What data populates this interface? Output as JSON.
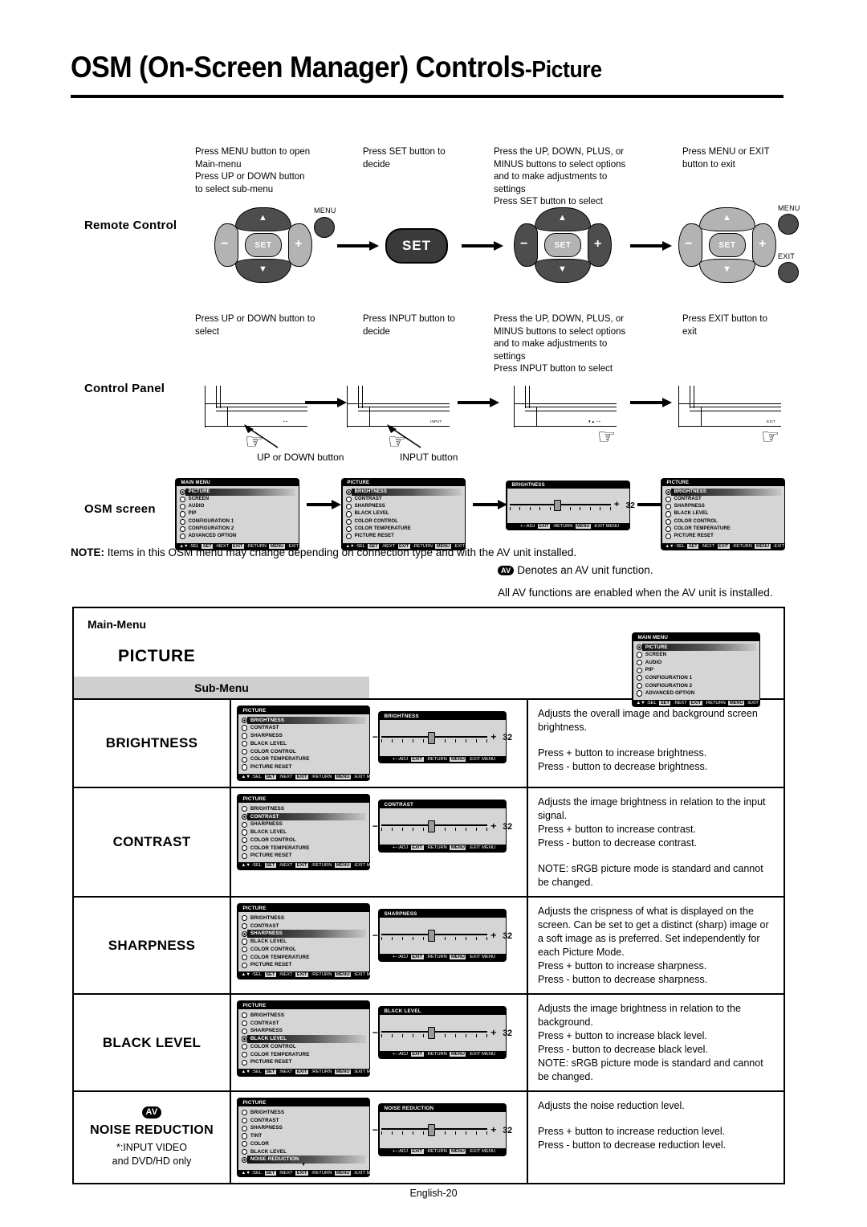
{
  "page": {
    "title_main": "OSM (On-Screen Manager) Controls",
    "title_sub": "-Picture",
    "footer": "English-20"
  },
  "rows": {
    "remote_label": "Remote Control",
    "control_label": "Control Panel",
    "osm_label": "OSM screen"
  },
  "remote_captions": [
    "Press MENU button to open\nMain-menu\nPress UP or DOWN button\nto select sub-menu",
    "Press SET button to\ndecide",
    "Press the UP, DOWN, PLUS, or\nMINUS buttons to select options\nand to make adjustments to\nsettings\nPress SET button to select",
    "Press MENU or EXIT\nbutton to exit"
  ],
  "panel_captions": [
    "Press UP or DOWN button to\nselect",
    "Press INPUT button to\ndecide",
    "Press the UP, DOWN, PLUS, or\nMINUS buttons to select options\nand to make adjustments to\nsettings\nPress INPUT button to select",
    "Press EXIT button to\nexit"
  ],
  "remote_buttons": {
    "set": "SET",
    "menu": "MENU",
    "exit": "EXIT",
    "plus": "+",
    "minus": "−",
    "up": "▲",
    "down": "▼"
  },
  "panel_hints": {
    "up_down": "UP or DOWN button",
    "input": "INPUT button",
    "panel_marks_1": "• •",
    "panel_marks_2": "INPUT",
    "panel_marks_3": "▼▲ −+",
    "panel_marks_4": "EXIT"
  },
  "note": {
    "label": "NOTE:",
    "line1": "Items in this OSM menu may change depending on connection type and with the AV unit installed.",
    "av_chip": "AV",
    "line2": "Denotes an AV unit function.",
    "line3": "All AV functions are enabled when the AV unit is installed."
  },
  "table_header": {
    "main_menu": "Main-Menu",
    "picture": "PICTURE",
    "sub_menu": "Sub-Menu"
  },
  "osm": {
    "footer_nav": [
      {
        "text": "▲▼ :SEL ",
        "key": false
      },
      {
        "text": "SET",
        "key": true
      },
      {
        "text": " :NEXT ",
        "key": false
      },
      {
        "text": "EXIT",
        "key": true
      },
      {
        "text": " :RETURN ",
        "key": false
      },
      {
        "text": "MENU",
        "key": true
      },
      {
        "text": " :EXIT MENU",
        "key": false
      }
    ],
    "footer_adj": [
      {
        "text": "+−:ADJ ",
        "key": false
      },
      {
        "text": "EXIT",
        "key": true
      },
      {
        "text": " :RETURN ",
        "key": false
      },
      {
        "text": "MENU",
        "key": true
      },
      {
        "text": " :EXIT MENU",
        "key": false
      }
    ],
    "main_menu": {
      "title": "MAIN MENU",
      "items": [
        "PICTURE",
        "SCREEN",
        "AUDIO",
        "PIP",
        "CONFIGURATION 1",
        "CONFIGURATION 2",
        "ADVANCED OPTION"
      ],
      "selected": 0
    },
    "picture_menu": {
      "title": "PICTURE",
      "items": [
        "BRIGHTNESS",
        "CONTRAST",
        "SHARPNESS",
        "BLACK LEVEL",
        "COLOR CONTROL",
        "COLOR TEMPERATURE",
        "PICTURE RESET"
      ]
    },
    "picture_menu_av": {
      "title": "PICTURE",
      "items": [
        "BRIGHTNESS",
        "CONTRAST",
        "SHARPNESS",
        "TINT",
        "COLOR",
        "BLACK LEVEL",
        "NOISE REDUCTION"
      ],
      "more": "▼"
    },
    "slider": {
      "value": "32",
      "minus": "−",
      "plus": "+"
    }
  },
  "table_rows": [
    {
      "name": "BRIGHTNESS",
      "menu_title": "PICTURE",
      "selected": 0,
      "slider_title": "BRIGHTNESS",
      "desc": [
        "Adjusts the overall image and background screen brightness.",
        "",
        "Press + button to increase brightness.",
        "Press - button to decrease brightness."
      ]
    },
    {
      "name": "CONTRAST",
      "menu_title": "PICTURE",
      "selected": 1,
      "slider_title": "CONTRAST",
      "desc": [
        "Adjusts the image brightness in relation to the input signal.",
        "Press + button to increase contrast.",
        "Press - button to decrease contrast.",
        "",
        "NOTE: sRGB picture mode is standard and cannot be changed."
      ]
    },
    {
      "name": "SHARPNESS",
      "menu_title": "PICTURE",
      "selected": 2,
      "slider_title": "SHARPNESS",
      "desc": [
        "Adjusts the crispness of what is displayed on the screen. Can be set to get a distinct (sharp) image or a soft image as is preferred. Set independently for each Picture Mode.",
        "Press + button to increase sharpness.",
        "Press - button to decrease sharpness."
      ]
    },
    {
      "name": "BLACK LEVEL",
      "menu_title": "PICTURE",
      "selected": 3,
      "slider_title": "BLACK LEVEL",
      "desc": [
        "Adjusts the image brightness in relation to the background.",
        "Press + button to increase black level.",
        "Press - button to decrease black level.",
        "NOTE: sRGB picture mode is standard and cannot be changed."
      ]
    },
    {
      "name": "NOISE REDUCTION",
      "av": "AV",
      "subnote": "*:INPUT VIDEO\nand DVD/HD only",
      "menu_title": "PICTURE",
      "selected": 6,
      "slider_title": "NOISE REDUCTION",
      "desc": [
        "Adjusts the noise reduction level.",
        "",
        "Press + button to increase reduction level.",
        "Press - button to decrease reduction level."
      ]
    }
  ]
}
